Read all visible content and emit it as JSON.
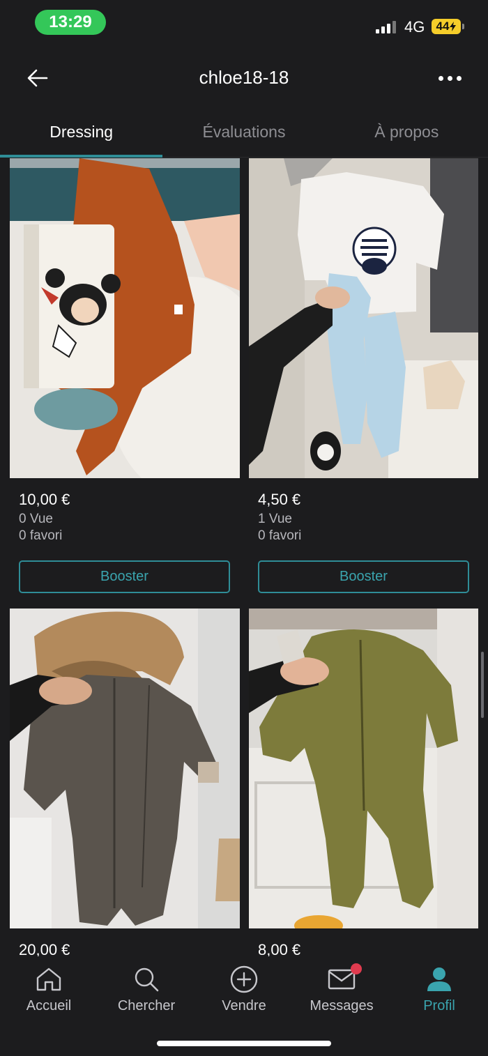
{
  "status_bar": {
    "time": "13:29",
    "network": "4G",
    "battery": "44"
  },
  "header": {
    "title": "chloe18-18"
  },
  "tabs": [
    {
      "label": "Dressing",
      "active": true
    },
    {
      "label": "Évaluations",
      "active": false
    },
    {
      "label": "À propos",
      "active": false
    }
  ],
  "items": [
    {
      "price": "10,00 €",
      "views": "0 Vue",
      "favorites": "0 favori",
      "booster_label": "Booster",
      "image_icon": "mickey-sweater-photo"
    },
    {
      "price": "4,50 €",
      "views": "1 Vue",
      "favorites": "0 favori",
      "booster_label": "Booster",
      "image_icon": "zebra-pyjama-photo"
    },
    {
      "price": "20,00 €",
      "image_icon": "khaki-snowsuit-photo"
    },
    {
      "price": "8,00 €",
      "image_icon": "green-fleece-onesie-photo"
    }
  ],
  "bottom_nav": [
    {
      "label": "Accueil",
      "icon": "home-icon",
      "active": false
    },
    {
      "label": "Chercher",
      "icon": "search-icon",
      "active": false
    },
    {
      "label": "Vendre",
      "icon": "plus-circle-icon",
      "active": false
    },
    {
      "label": "Messages",
      "icon": "mail-icon",
      "active": false,
      "has_notification": true
    },
    {
      "label": "Profil",
      "icon": "profile-icon",
      "active": true
    }
  ],
  "colors": {
    "accent": "#2f8d97",
    "background": "#1c1c1e",
    "status_green": "#34c759",
    "battery_yellow": "#f5cd2a",
    "notification_red": "#e03b4f"
  }
}
